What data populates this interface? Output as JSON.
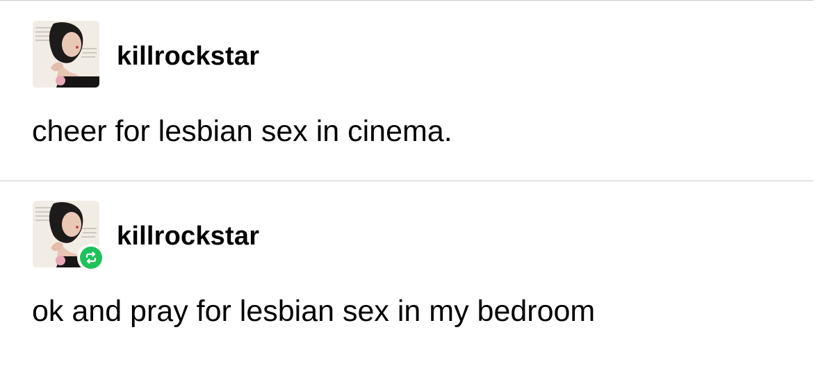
{
  "posts": [
    {
      "username": "killrockstar",
      "text": "cheer for lesbian sex in cinema.",
      "avatar_icon": "user-avatar-photo",
      "reblogged": false
    },
    {
      "username": "killrockstar",
      "text": "ok and pray for lesbian sex in my bedroom",
      "avatar_icon": "user-avatar-photo",
      "reblogged": true,
      "badge_icon": "reblog-icon"
    }
  ],
  "colors": {
    "divider": "#c8c8c8",
    "reblog_badge": "#1fc15a",
    "text": "#000000"
  }
}
